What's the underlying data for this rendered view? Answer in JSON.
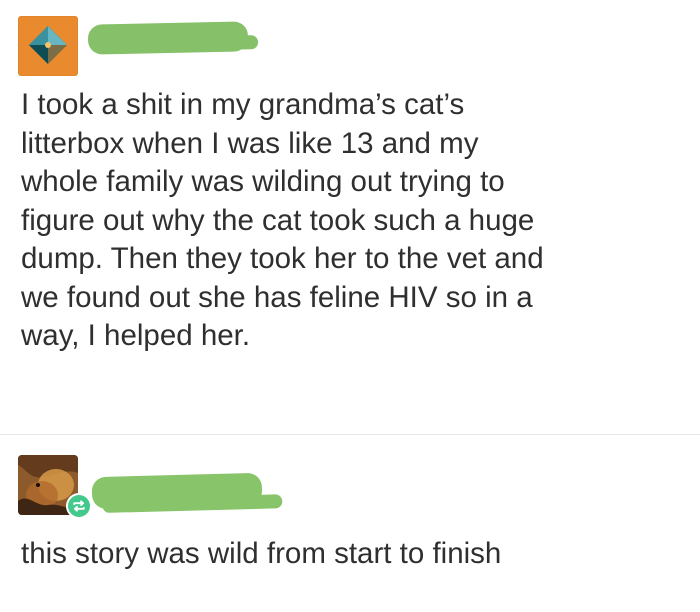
{
  "posts": [
    {
      "username_redacted": true,
      "avatar": "orange-diamond-avatar",
      "body": "I took a shit in my grandma’s cat’s\nlitterbox when I was like 13 and my\nwhole family was wilding out trying to\nfigure out why the cat took such a huge\ndump. Then they took her to the vet and\nwe found out she has feline HIV so in a\nway, I helped her."
    },
    {
      "username_redacted": true,
      "avatar": "brown-painting-avatar",
      "badge_icon": "reblog-icon",
      "body": "this story was wild from start to finish"
    }
  ],
  "colors": {
    "censor_green": "#86c069",
    "avatar_orange": "#e98a2f",
    "reblog_badge": "#43c98b"
  }
}
